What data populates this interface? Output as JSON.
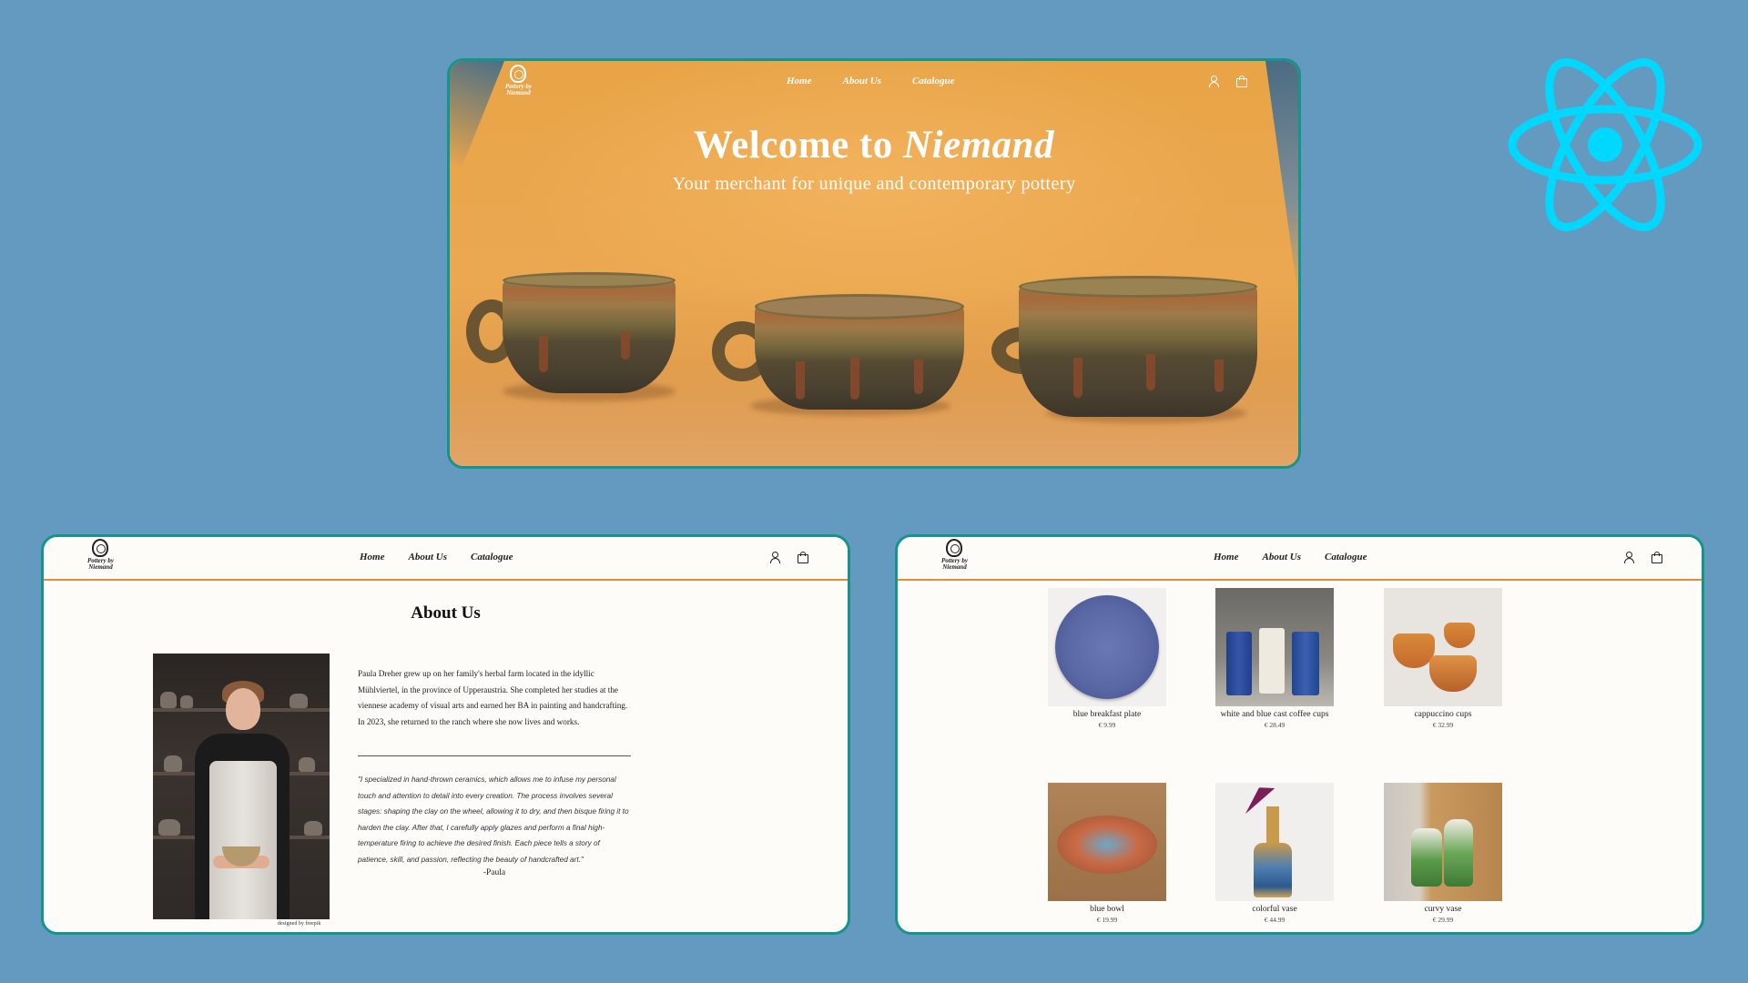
{
  "nav": {
    "logo_text": "Pottery by\nNiemand",
    "links": [
      "Home",
      "About Us",
      "Catalogue"
    ]
  },
  "hero": {
    "title_prefix": "Welcome to ",
    "title_brand": "Niemand",
    "subtitle": "Your merchant for unique and contemporary pottery"
  },
  "about": {
    "title": "About Us",
    "bio": "Paula Dreher grew up on her family's herbal farm located in the idyllic Mühlviertel, in the province of Upperaustria. She completed her studies at the viennese academy of visual arts and earned her BA in painting and handcrafting. In 2023, she returned to the ranch where she now lives and works.",
    "quote": "\"I specialized in hand-thrown ceramics, which allows me to infuse my personal touch and attention to detail into every creation. The process involves several stages: shaping the clay on the wheel, allowing it to dry, and then bisque firing it to harden the clay. After that, I carefully apply glazes and perform a final high-temperature firing to achieve the desired finish. Each piece tells a story of patience, skill, and passion, reflecting the beauty of handcrafted art.\"",
    "signature": "-Paula",
    "photo_credit": "designed by freepik"
  },
  "catalogue": {
    "products": [
      {
        "name": "blue breakfast plate",
        "price": "€ 9.99"
      },
      {
        "name": "white and blue cast coffee cups",
        "price": "€ 28.49"
      },
      {
        "name": "cappuccino cups",
        "price": "€ 32.99"
      },
      {
        "name": "blue bowl",
        "price": "€ 19.99"
      },
      {
        "name": "colorful vase",
        "price": "€ 44.99"
      },
      {
        "name": "curvy vase",
        "price": "€ 29.99"
      }
    ]
  },
  "colors": {
    "background": "#6499c0",
    "panel_border": "#14958c",
    "nav_underline": "#e38a3b",
    "react": "#00d8ff"
  },
  "icons": [
    "user-icon",
    "shopping-bag-icon",
    "react-logo-icon",
    "pottery-logo-icon"
  ]
}
